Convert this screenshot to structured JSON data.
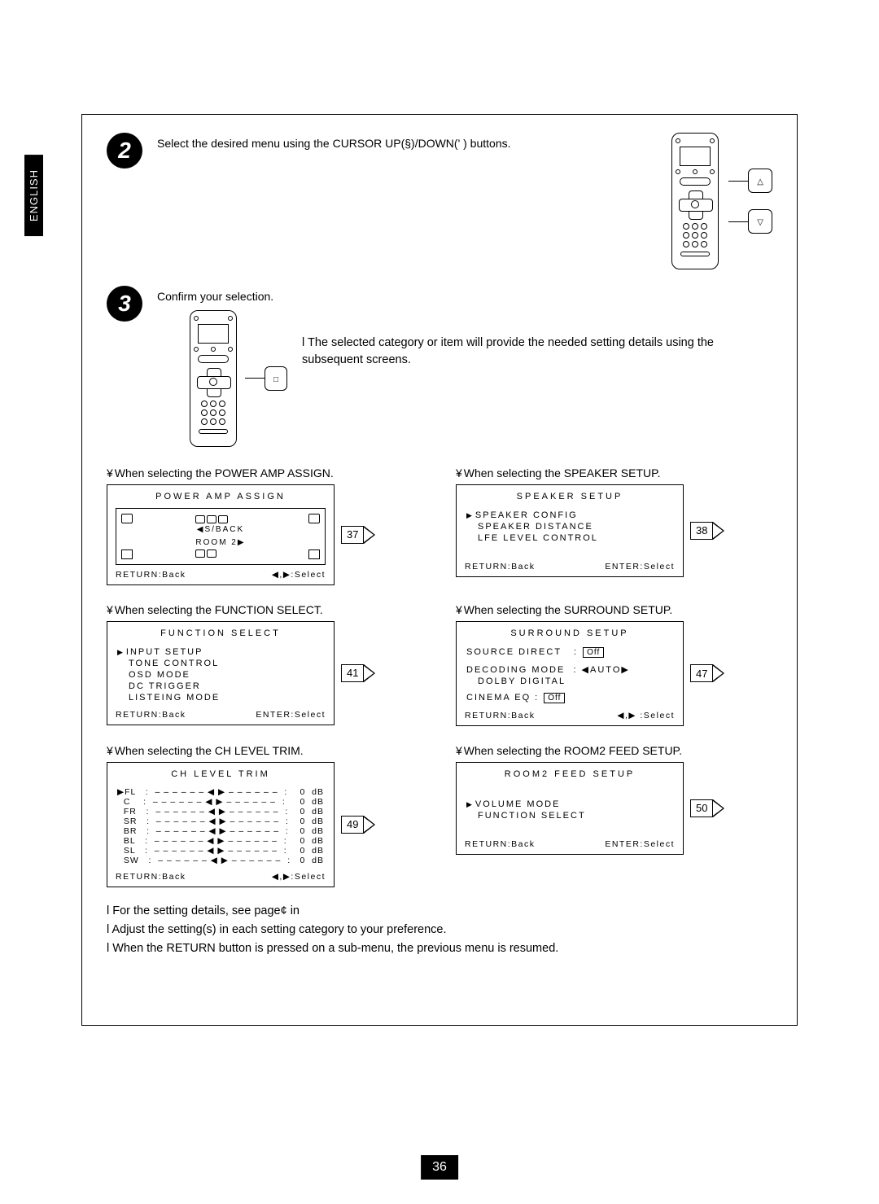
{
  "page_number": "36",
  "side_tab": "ENGLISH",
  "step2": {
    "num": "2",
    "text": "Select the desired menu using the CURSOR UP(§)/DOWN(' ) buttons.",
    "callout_up": "△",
    "callout_down": "▽"
  },
  "step3": {
    "num": "3",
    "text": "Confirm your selection.",
    "callout": "□",
    "info": "The selected category or item will provide the needed setting details using the subsequent screens."
  },
  "screens": {
    "power_amp": {
      "caption": "When selecting the POWER AMP ASSIGN.",
      "title": "POWER AMP ASSIGN",
      "mid_top": "◀S/BACK",
      "mid_bottom": "ROOM 2▶",
      "footer_left": "RETURN:Back",
      "footer_right": "◀,▶:Select",
      "page": "37"
    },
    "speaker_setup": {
      "caption": "When selecting the SPEAKER SETUP.",
      "title": "SPEAKER SETUP",
      "items": [
        "SPEAKER CONFIG",
        "SPEAKER DISTANCE",
        "LFE LEVEL CONTROL"
      ],
      "footer_left": "RETURN:Back",
      "footer_right": "ENTER:Select",
      "page": "38"
    },
    "function_select": {
      "caption": "When selecting the FUNCTION SELECT.",
      "title": "FUNCTION SELECT",
      "items": [
        "INPUT SETUP",
        "TONE CONTROL",
        "OSD MODE",
        "DC TRIGGER",
        "LISTEING MODE"
      ],
      "footer_left": "RETURN:Back",
      "footer_right": "ENTER:Select",
      "page": "41"
    },
    "surround_setup": {
      "caption": "When selecting the SURROUND SETUP.",
      "title": "SURROUND SETUP",
      "source_direct_label": "SOURCE DIRECT   :",
      "source_direct_val": "Off",
      "decoding_label": "DECODING MODE  : ◀AUTO▶",
      "decoding_sub": "DOLBY DIGITAL",
      "cinema_label": "CINEMA EQ :",
      "cinema_val": "Off",
      "footer_left": "RETURN:Back",
      "footer_right": "◀,▶ :Select",
      "page": "47"
    },
    "ch_level": {
      "caption": "When selecting the CH LEVEL TRIM.",
      "title": "CH   LEVEL   TRIM",
      "channels": [
        {
          "name": "FL",
          "val": "0  dB"
        },
        {
          "name": "C",
          "val": "0  dB"
        },
        {
          "name": "FR",
          "val": "0  dB"
        },
        {
          "name": "SR",
          "val": "0  dB"
        },
        {
          "name": "BR",
          "val": "0  dB"
        },
        {
          "name": "BL",
          "val": "0  dB"
        },
        {
          "name": "SL",
          "val": "0  dB"
        },
        {
          "name": "SW",
          "val": "0  dB"
        }
      ],
      "slider": "– – – – – – ◀ ▶ – – – – – –  :",
      "footer_left": "RETURN:Back",
      "footer_right": "◀,▶:Select",
      "page": "49"
    },
    "room2": {
      "caption": "When selecting the ROOM2 FEED SETUP.",
      "title": "ROOM2 FEED SETUP",
      "items": [
        "VOLUME MODE",
        "FUNCTION SELECT"
      ],
      "footer_left": "RETURN:Back",
      "footer_right": "ENTER:Select",
      "page": "50"
    }
  },
  "notes": [
    "For the setting details, see page¢ in",
    "Adjust the setting(s) in each setting category to your preference.",
    "When the RETURN button is pressed on a sub-menu, the previous menu is resumed."
  ]
}
